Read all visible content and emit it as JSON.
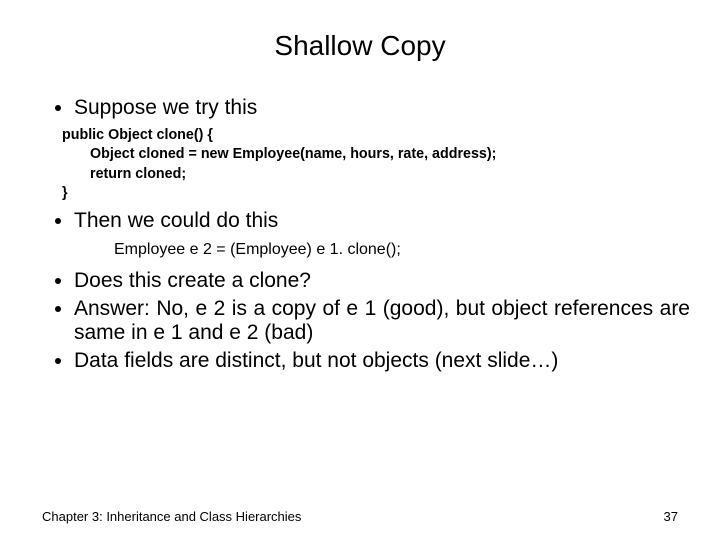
{
  "title": "Shallow Copy",
  "bullets": {
    "b1": "Suppose we try this",
    "b2": "Then we could do this",
    "b3": "Does this create a clone?",
    "b4": "Answer: No, e 2 is a copy of e 1 (good), but object references are same in e 1 and e 2 (bad)",
    "b5": "Data fields are distinct, but not objects (next slide…)"
  },
  "code1": {
    "l1": "public Object clone() {",
    "l2": "Object cloned = new Employee(name, hours, rate, address);",
    "l3": "return cloned;",
    "l4": "}"
  },
  "code2": {
    "l1": "Employee e 2 = (Employee) e 1. clone();"
  },
  "footer": {
    "left": "Chapter 3: Inheritance and Class Hierarchies",
    "right": "37"
  }
}
